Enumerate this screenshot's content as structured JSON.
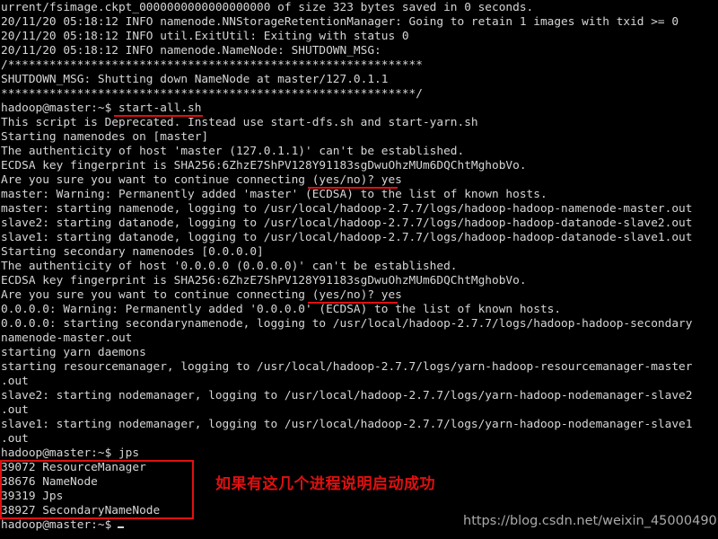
{
  "terminal": {
    "background_color": "#000000",
    "text_color": "#d6d6d6",
    "annotation_color": "#e01010",
    "prompt": "hadoop@master:~$",
    "lines": [
      "urrent/fsimage.ckpt_0000000000000000000 of size 323 bytes saved in 0 seconds.",
      "20/11/20 05:18:12 INFO namenode.NNStorageRetentionManager: Going to retain 1 images with txid >= 0",
      "20/11/20 05:18:12 INFO util.ExitUtil: Exiting with status 0",
      "20/11/20 05:18:12 INFO namenode.NameNode: SHUTDOWN_MSG:",
      "/************************************************************",
      "SHUTDOWN_MSG: Shutting down NameNode at master/127.0.1.1",
      "************************************************************/",
      "hadoop@master:~$ start-all.sh",
      "This script is Deprecated. Instead use start-dfs.sh and start-yarn.sh",
      "Starting namenodes on [master]",
      "The authenticity of host 'master (127.0.1.1)' can't be established.",
      "ECDSA key fingerprint is SHA256:6ZhzE7ShPV128Y91183sgDwuOhzMUm6DQChtMghobVo.",
      "Are you sure you want to continue connecting (yes/no)? yes",
      "master: Warning: Permanently added 'master' (ECDSA) to the list of known hosts.",
      "master: starting namenode, logging to /usr/local/hadoop-2.7.7/logs/hadoop-hadoop-namenode-master.out",
      "slave2: starting datanode, logging to /usr/local/hadoop-2.7.7/logs/hadoop-hadoop-datanode-slave2.out",
      "slave1: starting datanode, logging to /usr/local/hadoop-2.7.7/logs/hadoop-hadoop-datanode-slave1.out",
      "Starting secondary namenodes [0.0.0.0]",
      "The authenticity of host '0.0.0.0 (0.0.0.0)' can't be established.",
      "ECDSA key fingerprint is SHA256:6ZhzE7ShPV128Y91183sgDwuOhzMUm6DQChtMghobVo.",
      "Are you sure you want to continue connecting (yes/no)? yes",
      "0.0.0.0: Warning: Permanently added '0.0.0.0' (ECDSA) to the list of known hosts.",
      "0.0.0.0: starting secondarynamenode, logging to /usr/local/hadoop-2.7.7/logs/hadoop-hadoop-secondary",
      "namenode-master.out",
      "starting yarn daemons",
      "starting resourcemanager, logging to /usr/local/hadoop-2.7.7/logs/yarn-hadoop-resourcemanager-master",
      ".out",
      "slave2: starting nodemanager, logging to /usr/local/hadoop-2.7.7/logs/yarn-hadoop-nodemanager-slave2",
      ".out",
      "slave1: starting nodemanager, logging to /usr/local/hadoop-2.7.7/logs/yarn-hadoop-nodemanager-slave1",
      ".out",
      "hadoop@master:~$ jps",
      "39072 ResourceManager",
      "38676 NameNode",
      "39319 Jps",
      "38927 SecondaryNameNode"
    ],
    "final_prompt": "hadoop@master:~$"
  },
  "jps_processes": [
    {
      "pid": "39072",
      "name": "ResourceManager"
    },
    {
      "pid": "38676",
      "name": "NameNode"
    },
    {
      "pid": "39319",
      "name": "Jps"
    },
    {
      "pid": "38927",
      "name": "SecondaryNameNode"
    }
  ],
  "commands": {
    "start_all": "start-all.sh",
    "jps": "jps",
    "answer_yes": "yes"
  },
  "annotations": {
    "note_text": "如果有这几个进程说明启动成功",
    "watermark": "https://blog.csdn.net/weixin_45000490"
  }
}
